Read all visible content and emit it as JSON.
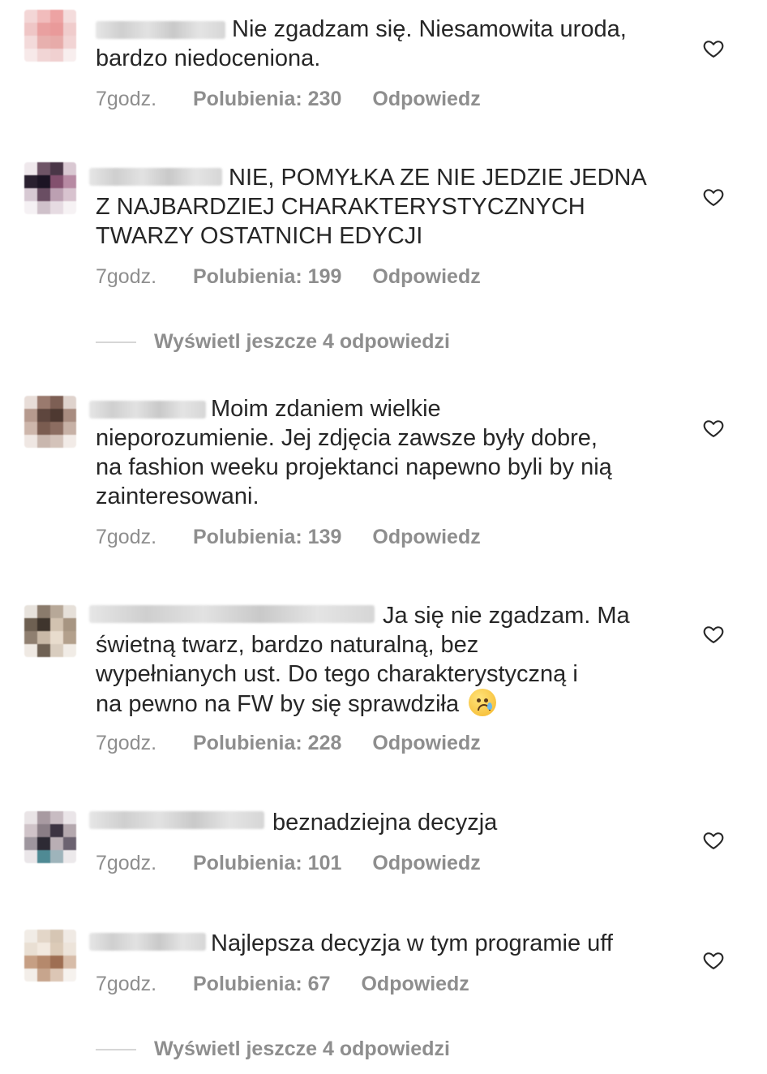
{
  "comments": [
    {
      "text": "Nie zgadzam się. Niesamowita uroda,\nbardzo niedoceniona.",
      "time": "7godz.",
      "likes": "Polubienia: 230",
      "reply": "Odpowiedz",
      "avatar_colors": [
        "#f3d6d6",
        "#f1bcbc",
        "#eda3a3",
        "#f4dcdc",
        "#efc6c6",
        "#e9a0a0",
        "#e99a9a",
        "#f0cccc",
        "#f3dada",
        "#e7b0ae",
        "#e7aba9",
        "#f2d4d4",
        "#f7e9e9",
        "#f1d5d5",
        "#f0d0d0",
        "#f8eeee"
      ]
    },
    {
      "text": "NIE, POMYŁKA ZE NIE JEDZIE JEDNA\nZ NAJBARDZIEJ CHARAKTERYSTYCZNYCH\nTWARZY OSTATNICH EDYCJI",
      "time": "7godz.",
      "likes": "Polubienia: 199",
      "reply": "Odpowiedz",
      "avatar_colors": [
        "#efe8ec",
        "#6e5466",
        "#4a3647",
        "#d9c8d2",
        "#2a2030",
        "#1c1424",
        "#83506e",
        "#b78aa3",
        "#d7c9d3",
        "#6a4e63",
        "#bca0b2",
        "#d8c3cf",
        "#f5f1f4",
        "#cfc1ca",
        "#e6dbe2",
        "#f6f2f4"
      ]
    },
    {
      "text": "Moim zdaniem wielkie\nnieporozumienie. Jej zdjęcia zawsze były dobre,\nna fashion weeku projektanci napewno byli by nią\nzainteresowani.",
      "time": "7godz.",
      "likes": "Polubienia: 139",
      "reply": "Odpowiedz",
      "avatar_colors": [
        "#e8ddd8",
        "#9a7a6e",
        "#7d5f54",
        "#dfd3cd",
        "#b69a8e",
        "#5e463e",
        "#4e3931",
        "#a88c80",
        "#cdb6ab",
        "#7a5c50",
        "#8c6d61",
        "#c7b1a6",
        "#efe7e3",
        "#c9b7ae",
        "#d4c3ba",
        "#f2ebe7"
      ]
    },
    {
      "text": "Ja się nie zgadzam. Ma\nświetną twarz, bardzo naturalną, bez\nwypełnianych ust. Do tego charakterystyczną i\nna pewno na FW by się sprawdziła",
      "time": "7godz.",
      "likes": "Polubienia: 228",
      "reply": "Odpowiedz",
      "avatar_colors": [
        "#e7e2dc",
        "#8a7b6c",
        "#b7a898",
        "#e6e0d9",
        "#6e6052",
        "#3f352d",
        "#d2c2b0",
        "#a79582",
        "#8f7f70",
        "#c9b9a7",
        "#e8dccd",
        "#b3a08c",
        "#efe9e3",
        "#6f6154",
        "#d9cdbf",
        "#f1ece6"
      ]
    },
    {
      "text": "beznadziejna decyzja",
      "time": "7godz.",
      "likes": "Polubienia: 101",
      "reply": "Odpowiedz",
      "avatar_colors": [
        "#e9e4e6",
        "#a89aa1",
        "#c8bcc2",
        "#eae5e8",
        "#cfc3c8",
        "#8a7e86",
        "#3c3442",
        "#b4a8ae",
        "#9e969e",
        "#2d2a34",
        "#b9aeb4",
        "#6b6270",
        "#eae6e9",
        "#4f8a94",
        "#9eb4bb",
        "#ece9eb"
      ]
    },
    {
      "text": "Najlepsza decyzja w tym programie uff",
      "time": "7godz.",
      "likes": "Polubienia: 67",
      "reply": "Odpowiedz",
      "avatar_colors": [
        "#f1ece6",
        "#e3d6c8",
        "#d6c6b4",
        "#f0eae4",
        "#e9dfd3",
        "#f2e9df",
        "#dccbb8",
        "#ede4da",
        "#c69f84",
        "#b5896c",
        "#9e6e52",
        "#d7bca8",
        "#f3eee9",
        "#c7a58d",
        "#dcc6b5",
        "#f6f2ee"
      ]
    }
  ],
  "view_more": [
    "Wyświetl jeszcze 4 odpowiedzi",
    "Wyświetl jeszcze 4 odpowiedzi"
  ],
  "icons": {
    "like": "heart-outline-icon",
    "emoji": "crying-face-emoji"
  },
  "colors": {
    "text": "#262626",
    "meta": "#8e8e8e",
    "divider": "#d6d6d6"
  }
}
